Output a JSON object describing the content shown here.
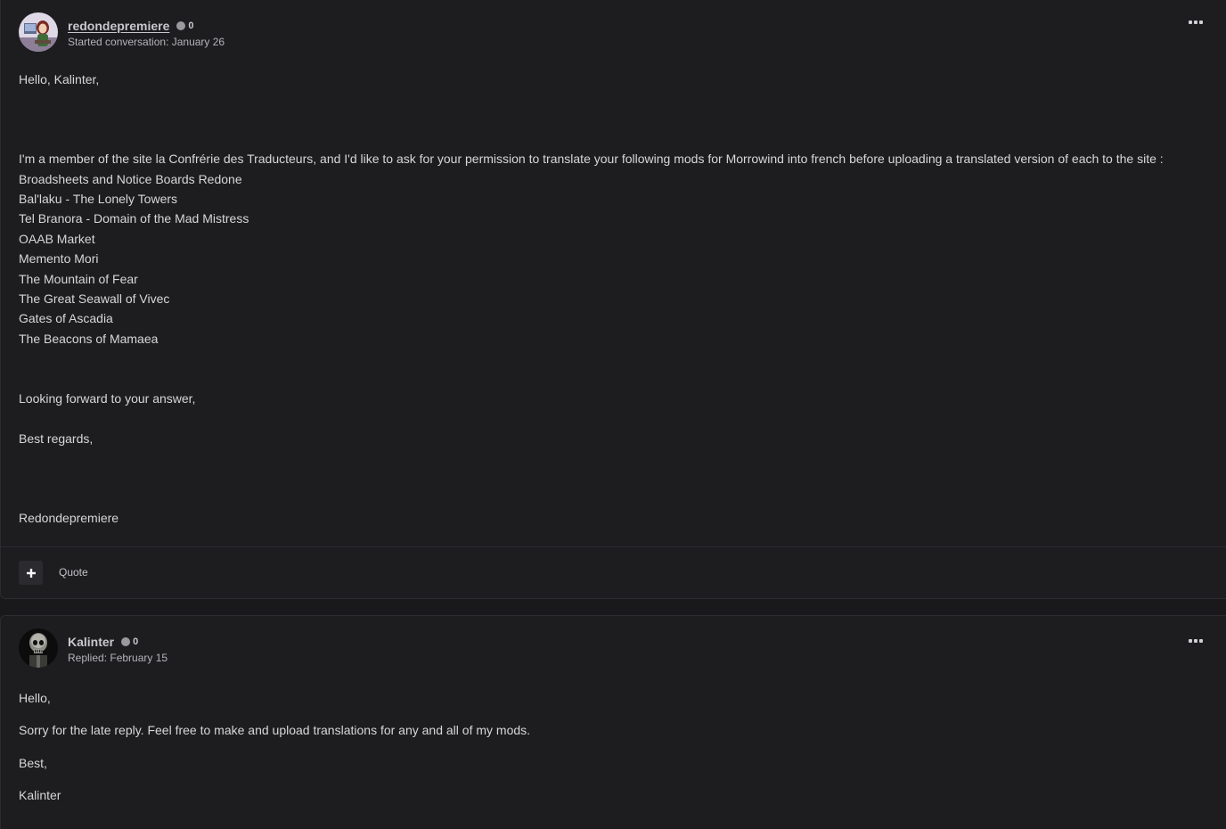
{
  "posts": [
    {
      "author": "redondepremiere",
      "reputation": "0",
      "meta": "Started conversation: January 26",
      "lines": [
        "Hello, Kalinter,",
        "I'm a member of the site la Confrérie des Traducteurs, and I'd like to ask for your permission to translate your following mods for Morrowind into french before uploading a translated version of each to the site :",
        "Broadsheets and Notice Boards Redone",
        "Bal'laku - The Lonely Towers",
        "Tel Branora - Domain of the Mad Mistress",
        "OAAB Market",
        "Memento Mori",
        "The Mountain of Fear",
        "The Great Seawall of Vivec",
        "Gates of Ascadia",
        "The Beacons of Mamaea",
        "Looking forward to your answer,",
        "Best regards,",
        "Redondepremiere"
      ],
      "footer": {
        "quote_label": "Quote",
        "plus_icon": "plus-icon"
      }
    },
    {
      "author": "Kalinter",
      "reputation": "0",
      "meta": "Replied: February 15",
      "lines": [
        "Hello,",
        "Sorry for the late reply. Feel free to make and upload translations for any and all of my mods.",
        "Best,",
        "Kalinter"
      ]
    }
  ],
  "icons": {
    "menu": "ellipsis-icon",
    "reputation": "reputation-dot-icon"
  },
  "colors": {
    "background": "#19191b",
    "post_background": "#1d1d20",
    "text": "#d7d7d9",
    "muted": "#b4b4b8",
    "border": "#2c2c30"
  }
}
